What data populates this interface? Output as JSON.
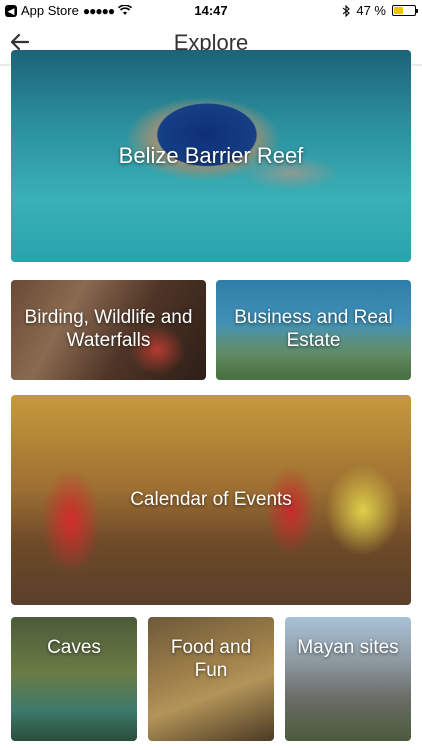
{
  "status_bar": {
    "carrier": "App Store",
    "signal": "●●●●●",
    "time": "14:47",
    "battery_percent": "47 %",
    "battery_level": 0.47
  },
  "nav": {
    "title": "Explore"
  },
  "tiles": [
    {
      "label": "Belize Barrier Reef"
    },
    {
      "label": "Birding, Wildlife and Waterfalls"
    },
    {
      "label": "Business and Real Estate"
    },
    {
      "label": "Calendar of Events"
    },
    {
      "label": "Caves"
    },
    {
      "label": "Food and Fun"
    },
    {
      "label": "Mayan sites"
    }
  ],
  "colors": {
    "battery_fill": "#f2c200",
    "title_text": "#333333"
  }
}
